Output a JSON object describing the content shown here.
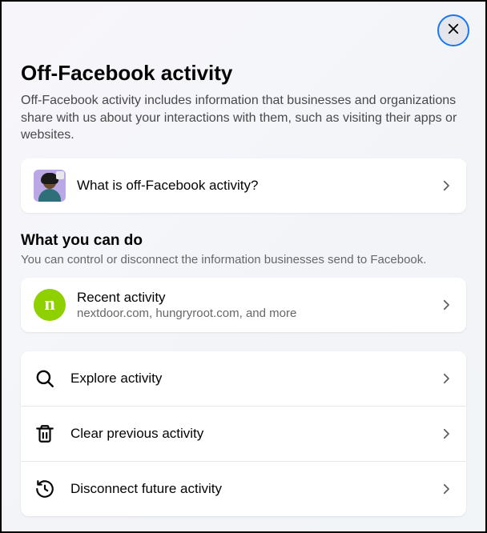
{
  "header": {
    "title": "Off-Facebook activity",
    "description": "Off-Facebook activity includes information that businesses and organizations share with us about your interactions with them, such as visiting their apps or websites."
  },
  "explainer": {
    "label": "What is off-Facebook activity?"
  },
  "section": {
    "title": "What you can do",
    "subtitle": "You can control or disconnect the information businesses send to Facebook."
  },
  "recent": {
    "title": "Recent activity",
    "subtitle": "nextdoor.com, hungryroot.com, and more",
    "badge": "n"
  },
  "actions": {
    "explore": "Explore activity",
    "clear": "Clear previous activity",
    "disconnect": "Disconnect future activity"
  }
}
